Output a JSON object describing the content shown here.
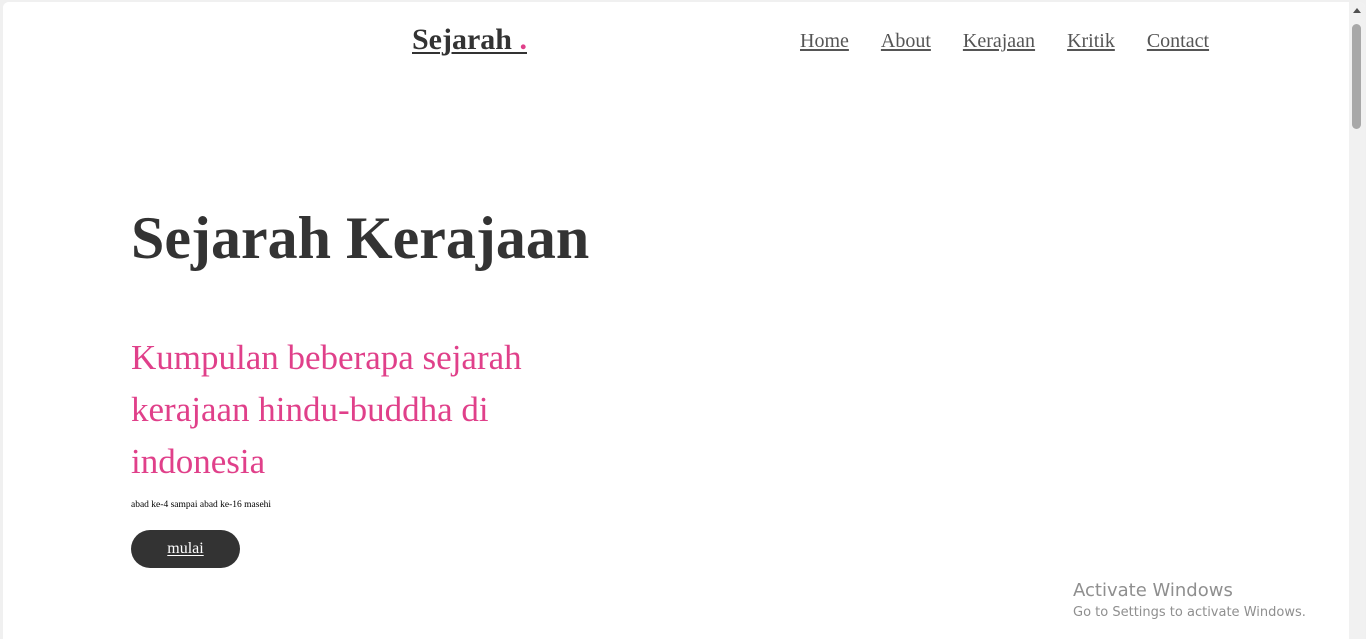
{
  "header": {
    "logo_text": "Sejarah ",
    "logo_dot": ".",
    "nav": [
      {
        "label": "Home"
      },
      {
        "label": "About"
      },
      {
        "label": "Kerajaan"
      },
      {
        "label": "Kritik"
      },
      {
        "label": "Contact"
      }
    ]
  },
  "hero": {
    "title": "Sejarah Kerajaan",
    "subtitle": "Kumpulan beberapa sejarah kerajaan hindu-buddha di indonesia",
    "note": "abad ke-4 sampai abad ke-16 masehi",
    "cta_label": "mulai"
  },
  "watermark": {
    "title": "Activate Windows",
    "subtitle": "Go to Settings to activate Windows."
  },
  "colors": {
    "accent": "#e0408a",
    "text_dark": "#333333",
    "button_bg": "#333333"
  }
}
